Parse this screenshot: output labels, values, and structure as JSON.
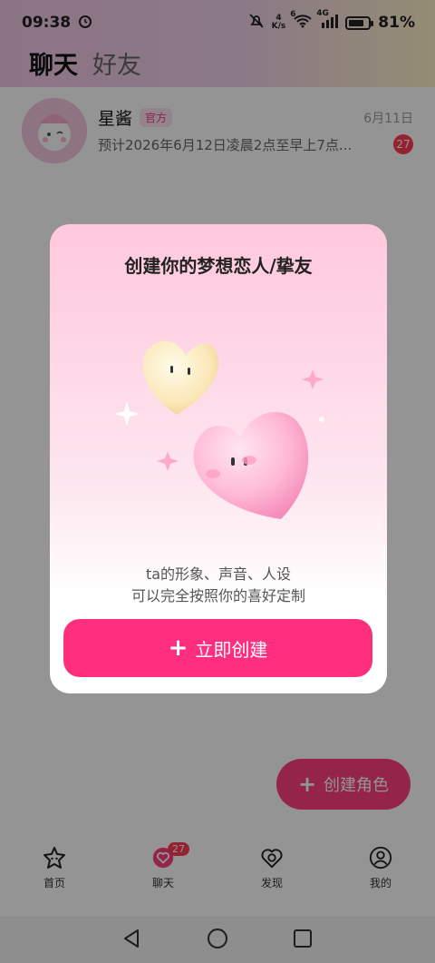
{
  "status_bar": {
    "time": "09:38",
    "net_speed_value": "4",
    "net_speed_unit": "K/s",
    "wifi_label": "6",
    "signal_label": "4G",
    "battery": "81%",
    "battery_level": 0.81
  },
  "tabs": {
    "chat": "聊天",
    "friends": "好友"
  },
  "chats": [
    {
      "name": "星酱",
      "badge": "官方",
      "time": "6月11日",
      "preview": "预计2026年6月12日凌晨2点至早上7点...",
      "unread": "27"
    }
  ],
  "modal": {
    "title": "创建你的梦想恋人/挚友",
    "subtitle_line1": "ta的形象、声音、人设",
    "subtitle_line2": "可以完全按照你的喜好定制",
    "button_label": "立即创建"
  },
  "fab": {
    "label": "创建角色"
  },
  "bottom_nav": {
    "home": "首页",
    "chat": "聊天",
    "chat_badge": "27",
    "discover": "发现",
    "me": "我的"
  },
  "colors": {
    "accent": "#ff2e7e",
    "badge_red": "#ff3b55"
  }
}
